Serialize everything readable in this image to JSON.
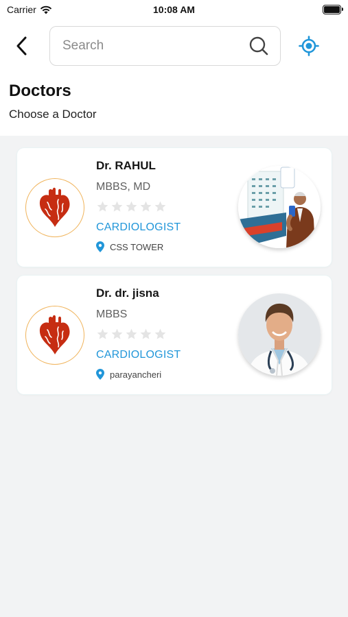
{
  "status_bar": {
    "carrier": "Carrier",
    "time": "10:08 AM"
  },
  "header": {
    "search_placeholder": "Search",
    "title": "Doctors",
    "subtitle": "Choose a Doctor"
  },
  "doctors": [
    {
      "name": "Dr. RAHUL",
      "degree": "MBBS, MD",
      "rating": 0,
      "specialization": "CARDIOLOGIST",
      "location": "CSS TOWER",
      "specialty_icon": "heart-icon",
      "photo": "doctor-app-promo-photo"
    },
    {
      "name": "Dr. dr. jisna",
      "degree": "MBBS",
      "rating": 0,
      "specialization": "CARDIOLOGIST",
      "location": "parayancheri",
      "specialty_icon": "heart-icon",
      "photo": "doctor-portrait-photo"
    }
  ],
  "colors": {
    "accent": "#2196d9",
    "heart": "#c62d12",
    "icon_ring": "#f0b35a",
    "star_empty": "#e4e4e4",
    "background": "#f2f3f4"
  }
}
